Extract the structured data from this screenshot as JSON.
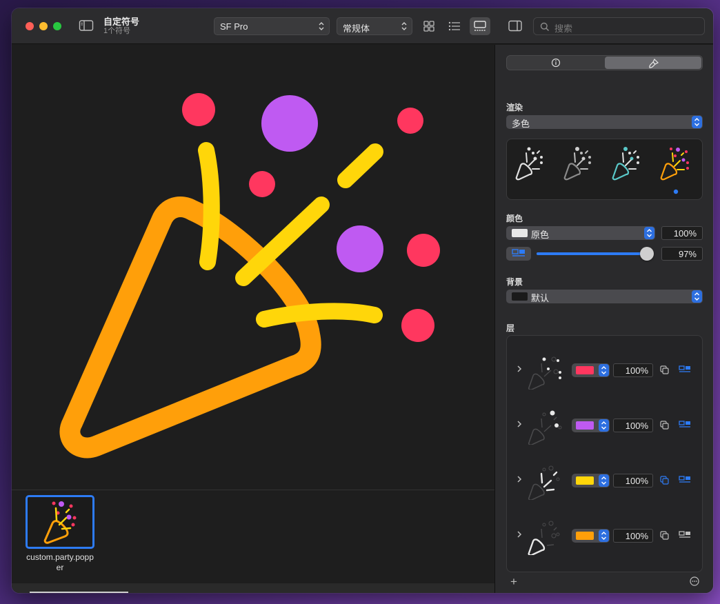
{
  "window": {
    "title": "自定符号",
    "subtitle": "1个符号"
  },
  "toolbar": {
    "font_family": "SF Pro",
    "font_weight": "常规体",
    "search_placeholder": "搜索"
  },
  "gallery": {
    "symbol_name": "custom.party.popper"
  },
  "inspector": {
    "rendering_label": "渲染",
    "rendering_mode": "多色",
    "color_label": "颜色",
    "color_value": "原色",
    "color_opacity": "100%",
    "slider_value": "97%",
    "slider_fraction": 0.97,
    "background_label": "背景",
    "background_value": "默认",
    "layers_label": "层",
    "layers": [
      {
        "color": "#ff375f",
        "opacity": "100%"
      },
      {
        "color": "#bf5af2",
        "opacity": "100%"
      },
      {
        "color": "#ffd60a",
        "opacity": "100%"
      },
      {
        "color": "#ff9f0a",
        "opacity": "100%"
      }
    ],
    "add_label": "+"
  },
  "colors": {
    "red": "#ff375f",
    "purple": "#bf5af2",
    "yellow": "#ffd60a",
    "orange": "#ff9f0a",
    "accent": "#2d7bf5"
  }
}
